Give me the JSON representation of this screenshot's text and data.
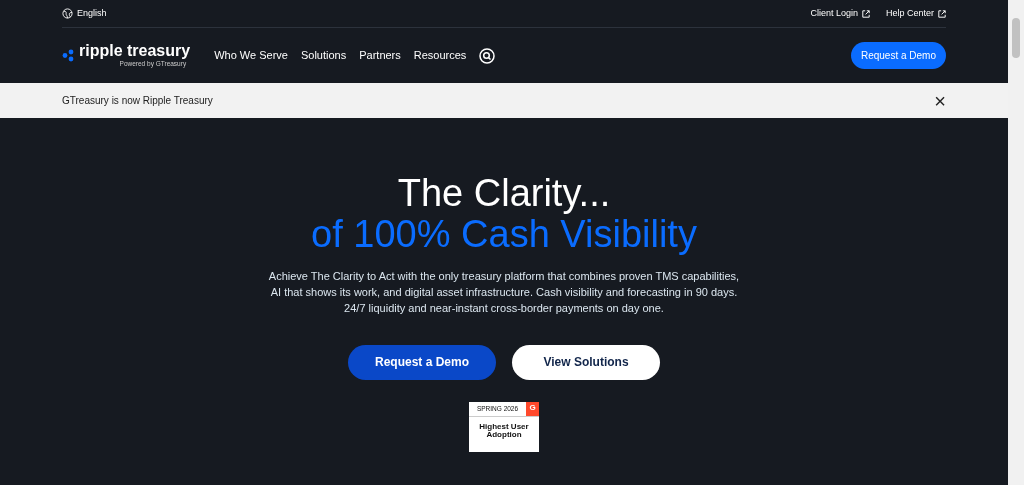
{
  "top_bar": {
    "language": "English",
    "links": [
      "Client Login",
      "Help Center"
    ]
  },
  "navbar": {
    "logo": {
      "name": "ripple treasury",
      "tagline": "Powered by GTreasury"
    },
    "items": [
      "Who We Serve",
      "Solutions",
      "Partners",
      "Resources"
    ],
    "cta": "Request a Demo"
  },
  "announcement": {
    "text": "GTreasury is now Ripple Treasury",
    "close": "×"
  },
  "hero": {
    "title": "The Clarity...",
    "subtitle": "of 100% Cash Visibility",
    "description": "Achieve The Clarity to Act with the only treasury platform that combines proven TMS capabilities, AI that shows its work, and digital asset infrastructure. Cash visibility and forecasting in 90 days. 24/7 liquidity and near-instant cross-border payments on day one.",
    "buttons": [
      {
        "label": "Request a Demo",
        "kind": "primary"
      },
      {
        "label": "View Solutions",
        "kind": "secondary"
      }
    ],
    "award": {
      "season": "SPRING 2026",
      "logo": "G",
      "title": "Highest User Adoption"
    }
  }
}
